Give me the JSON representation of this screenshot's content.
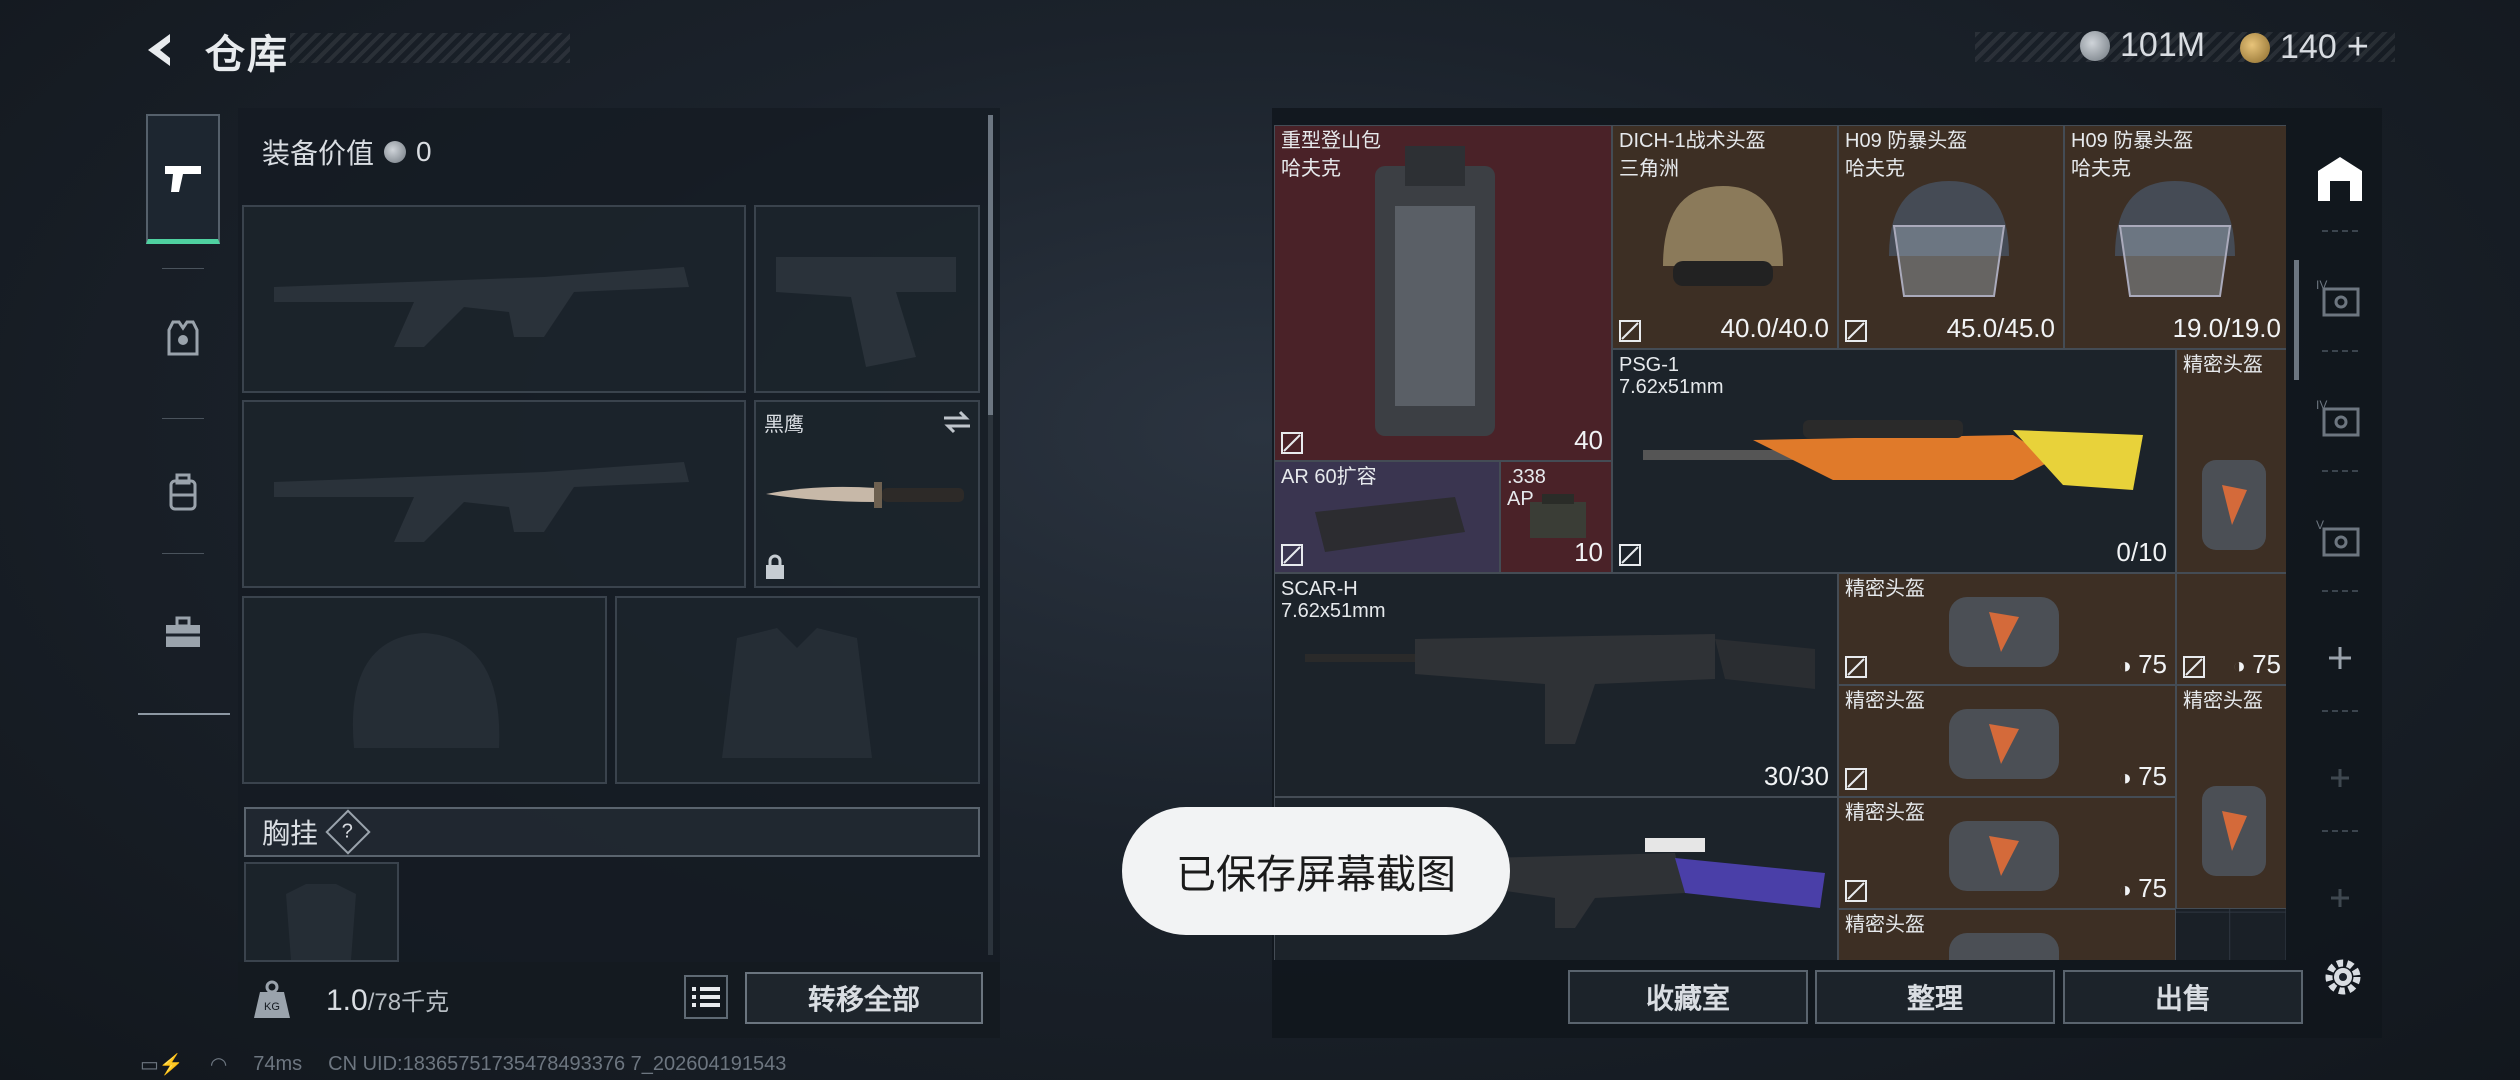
{
  "header": {
    "title": "仓库",
    "currency_1": "101M",
    "currency_2": "140"
  },
  "equipment": {
    "label": "装备价值",
    "value": "0"
  },
  "left_slots": {
    "melee_name": "黑鹰",
    "chest_label": "胸挂",
    "chest_help": "?"
  },
  "weight": {
    "value": "1.0",
    "max": "/78千克",
    "transfer_label": "转移全部"
  },
  "items": [
    {
      "name": "重型登山包",
      "sub": "哈夫克",
      "value": "40"
    },
    {
      "name": "DICH-1战术头盔",
      "sub": "三角洲",
      "value": "40.0/40.0"
    },
    {
      "name": "H09 防暴头盔",
      "sub": "哈夫克",
      "value": "45.0/45.0"
    },
    {
      "name": "H09 防暴头盔",
      "sub": "哈夫克",
      "value": "19.0/19.0"
    },
    {
      "name": "PSG-1",
      "sub": "7.62x51mm",
      "value": "0/10"
    },
    {
      "name": "精密头盔",
      "sub": "",
      "value": ""
    },
    {
      "name": "AR 60扩容",
      "sub": "",
      "value": ""
    },
    {
      "name": ".338",
      "sub": "AP",
      "value": "10"
    },
    {
      "name": "SCAR-H",
      "sub": "7.62x51mm",
      "value": "30/30"
    },
    {
      "name": "精密头盔",
      "sub": "",
      "value": "75"
    },
    {
      "name": "精密头盔",
      "sub": "",
      "value": "75"
    },
    {
      "name": "精密头盔",
      "sub": "",
      "value": "75"
    },
    {
      "name": "精密头盔",
      "sub": "",
      "value": ""
    },
    {
      "name": "精密头盔",
      "sub": "",
      "value": "75"
    },
    {
      "name": "精密头盔",
      "sub": "",
      "value": ""
    }
  ],
  "buttons": {
    "collection": "收藏室",
    "sort": "整理",
    "sell": "出售"
  },
  "toast": "已保存屏幕截图",
  "status": {
    "ping": "74ms",
    "uid": "CN UID:18365751735478493376 7_202604191543"
  },
  "colors": {
    "accent": "#4fd1a0",
    "red_cell": "#4a2228",
    "brown_cell": "#3d2f24",
    "purple_cell": "#3a3550"
  }
}
